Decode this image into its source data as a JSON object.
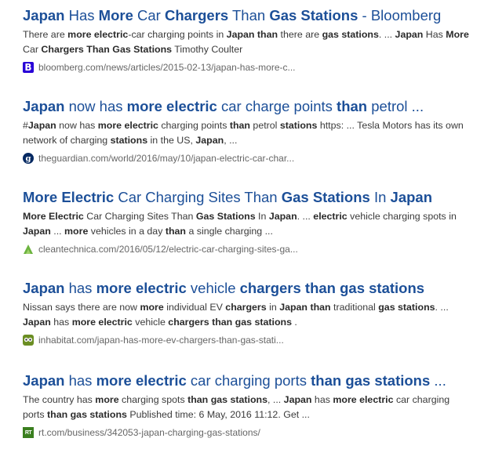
{
  "results": [
    {
      "title_segments": [
        {
          "t": "Japan",
          "b": true
        },
        {
          "t": " Has ",
          "b": false
        },
        {
          "t": "More",
          "b": true
        },
        {
          "t": " Car ",
          "b": false
        },
        {
          "t": "Chargers",
          "b": true
        },
        {
          "t": " Than ",
          "b": false
        },
        {
          "t": "Gas Stations",
          "b": true
        },
        {
          "t": " - Bloomberg",
          "b": false
        }
      ],
      "snippet_segments": [
        {
          "t": "There are ",
          "b": false
        },
        {
          "t": "more electric",
          "b": true
        },
        {
          "t": "-car charging points in ",
          "b": false
        },
        {
          "t": "Japan than",
          "b": true
        },
        {
          "t": " there are ",
          "b": false
        },
        {
          "t": "gas stations",
          "b": true
        },
        {
          "t": ". ... ",
          "b": false
        },
        {
          "t": "Japan",
          "b": true
        },
        {
          "t": " Has ",
          "b": false
        },
        {
          "t": "More",
          "b": true
        },
        {
          "t": " Car ",
          "b": false
        },
        {
          "t": "Chargers Than Gas Stations",
          "b": true
        },
        {
          "t": " Timothy Coulter",
          "b": false
        }
      ],
      "url": "bloomberg.com/news/articles/2015-02-13/japan-has-more-c...",
      "favicon": "bloomberg-favicon"
    },
    {
      "title_segments": [
        {
          "t": "Japan",
          "b": true
        },
        {
          "t": " now has ",
          "b": false
        },
        {
          "t": "more electric",
          "b": true
        },
        {
          "t": " car charge points ",
          "b": false
        },
        {
          "t": "than",
          "b": true
        },
        {
          "t": " petrol ...",
          "b": false
        }
      ],
      "snippet_segments": [
        {
          "t": "#",
          "b": false
        },
        {
          "t": "Japan",
          "b": true
        },
        {
          "t": " now has ",
          "b": false
        },
        {
          "t": "more electric",
          "b": true
        },
        {
          "t": " charging points ",
          "b": false
        },
        {
          "t": "than",
          "b": true
        },
        {
          "t": " petrol ",
          "b": false
        },
        {
          "t": "stations",
          "b": true
        },
        {
          "t": " https: ... Tesla Motors has its own network of charging ",
          "b": false
        },
        {
          "t": "stations",
          "b": true
        },
        {
          "t": " in the US, ",
          "b": false
        },
        {
          "t": "Japan",
          "b": true
        },
        {
          "t": ", ...",
          "b": false
        }
      ],
      "url": "theguardian.com/world/2016/may/10/japan-electric-car-char...",
      "favicon": "guardian-favicon"
    },
    {
      "title_segments": [
        {
          "t": "More Electric",
          "b": true
        },
        {
          "t": " Car Charging Sites Than ",
          "b": false
        },
        {
          "t": "Gas Stations",
          "b": true
        },
        {
          "t": " In ",
          "b": false
        },
        {
          "t": "Japan",
          "b": true
        }
      ],
      "snippet_segments": [
        {
          "t": "More Electric",
          "b": true
        },
        {
          "t": " Car Charging Sites Than ",
          "b": false
        },
        {
          "t": "Gas Stations",
          "b": true
        },
        {
          "t": " In ",
          "b": false
        },
        {
          "t": "Japan",
          "b": true
        },
        {
          "t": ". ... ",
          "b": false
        },
        {
          "t": "electric",
          "b": true
        },
        {
          "t": " vehicle charging spots in ",
          "b": false
        },
        {
          "t": "Japan",
          "b": true
        },
        {
          "t": " ... ",
          "b": false
        },
        {
          "t": "more",
          "b": true
        },
        {
          "t": " vehicles in a day ",
          "b": false
        },
        {
          "t": "than",
          "b": true
        },
        {
          "t": " a single charging ...",
          "b": false
        }
      ],
      "url": "cleantechnica.com/2016/05/12/electric-car-charging-sites-ga...",
      "favicon": "cleantechnica-favicon"
    },
    {
      "title_segments": [
        {
          "t": "Japan",
          "b": true
        },
        {
          "t": " has ",
          "b": false
        },
        {
          "t": "more electric",
          "b": true
        },
        {
          "t": " vehicle ",
          "b": false
        },
        {
          "t": "chargers than gas stations",
          "b": true
        }
      ],
      "snippet_segments": [
        {
          "t": "Nissan says there are now ",
          "b": false
        },
        {
          "t": "more",
          "b": true
        },
        {
          "t": " individual EV ",
          "b": false
        },
        {
          "t": "chargers",
          "b": true
        },
        {
          "t": " in ",
          "b": false
        },
        {
          "t": "Japan than",
          "b": true
        },
        {
          "t": " traditional ",
          "b": false
        },
        {
          "t": "gas stations",
          "b": true
        },
        {
          "t": ". ... ",
          "b": false
        },
        {
          "t": "Japan",
          "b": true
        },
        {
          "t": " has ",
          "b": false
        },
        {
          "t": "more electric",
          "b": true
        },
        {
          "t": " vehicle ",
          "b": false
        },
        {
          "t": "chargers than gas stations",
          "b": true
        },
        {
          "t": " .",
          "b": false
        }
      ],
      "url": "inhabitat.com/japan-has-more-ev-chargers-than-gas-stati...",
      "favicon": "inhabitat-favicon"
    },
    {
      "title_segments": [
        {
          "t": "Japan",
          "b": true
        },
        {
          "t": " has ",
          "b": false
        },
        {
          "t": "more electric",
          "b": true
        },
        {
          "t": " car charging ports ",
          "b": false
        },
        {
          "t": "than",
          "b": true
        },
        {
          "t": " ",
          "b": false
        },
        {
          "t": "gas stations",
          "b": true
        },
        {
          "t": " ...",
          "b": false
        }
      ],
      "snippet_segments": [
        {
          "t": "The country has ",
          "b": false
        },
        {
          "t": "more",
          "b": true
        },
        {
          "t": " charging spots ",
          "b": false
        },
        {
          "t": "than",
          "b": true
        },
        {
          "t": " ",
          "b": false
        },
        {
          "t": "gas stations",
          "b": true
        },
        {
          "t": ", ... ",
          "b": false
        },
        {
          "t": "Japan",
          "b": true
        },
        {
          "t": " has ",
          "b": false
        },
        {
          "t": "more electric",
          "b": true
        },
        {
          "t": " car charging ports ",
          "b": false
        },
        {
          "t": "than",
          "b": true
        },
        {
          "t": " ",
          "b": false
        },
        {
          "t": "gas stations",
          "b": true
        },
        {
          "t": " Published time: 6 May, 2016 11:12. Get ...",
          "b": false
        }
      ],
      "url": "rt.com/business/342053-japan-charging-gas-stations/",
      "favicon": "rt-favicon",
      "favicon_text": "RT"
    }
  ],
  "colors": {
    "title": "#1c4f98",
    "snippet": "#3b3b3b",
    "url": "#666666",
    "bloomberg": "#2800d7",
    "guardian": "#052962",
    "cleantechnica": "#6cb33f",
    "inhabitat": "#6b8e23",
    "rt": "#3a7f1f"
  }
}
